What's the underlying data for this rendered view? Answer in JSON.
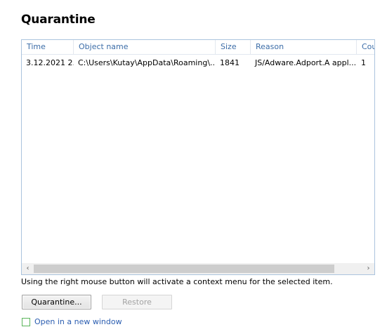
{
  "page": {
    "title": "Quarantine"
  },
  "table": {
    "columns": [
      "Time",
      "Object name",
      "Size",
      "Reason",
      "Cou"
    ],
    "rows": [
      {
        "time": "3.12.2021 2...",
        "object_name": "C:\\Users\\Kutay\\AppData\\Roaming\\...",
        "size": "1841",
        "reason": "JS/Adware.Adport.A appl...",
        "count": "1"
      }
    ]
  },
  "scrollbar": {
    "left_arrow": "‹",
    "right_arrow": "›"
  },
  "hint_text": "Using the right mouse button will activate a context menu for the selected item.",
  "buttons": {
    "quarantine_label": "Quarantine...",
    "restore_label": "Restore"
  },
  "open_new_window": {
    "label": "Open in a new window"
  }
}
